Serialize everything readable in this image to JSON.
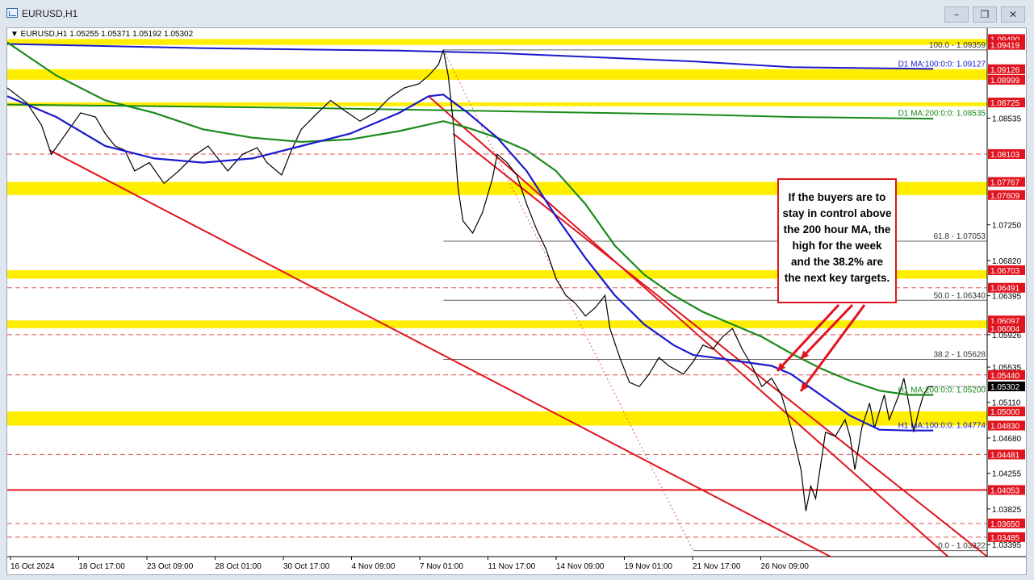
{
  "window": {
    "title": "EURUSD,H1",
    "buttons": [
      "–",
      "❐",
      "✕"
    ]
  },
  "chart_data": {
    "type": "line",
    "symbol_header": "▼ EURUSD,H1  1.05255 1.05371 1.05192 1.05302",
    "current_price": "1.05302",
    "ylim": [
      1.0325,
      1.0962
    ],
    "price_labels": [
      {
        "value": 1.0949,
        "text": "1.09490",
        "style": "box"
      },
      {
        "value": 1.09419,
        "text": "1.09419",
        "style": "box"
      },
      {
        "value": 1.09126,
        "text": "1.09126",
        "style": "box"
      },
      {
        "value": 1.08999,
        "text": "1.08999",
        "style": "box"
      },
      {
        "value": 1.08725,
        "text": "1.08725",
        "style": "box"
      },
      {
        "value": 1.08535,
        "text": "1.08535",
        "style": "plain"
      },
      {
        "value": 1.08103,
        "text": "1.08103",
        "style": "box"
      },
      {
        "value": 1.07767,
        "text": "1.07767",
        "style": "box"
      },
      {
        "value": 1.07609,
        "text": "1.07609",
        "style": "box"
      },
      {
        "value": 1.0725,
        "text": "1.07250",
        "style": "plain"
      },
      {
        "value": 1.0682,
        "text": "1.06820",
        "style": "plain"
      },
      {
        "value": 1.06703,
        "text": "1.06703",
        "style": "box"
      },
      {
        "value": 1.06491,
        "text": "1.06491",
        "style": "box"
      },
      {
        "value": 1.06395,
        "text": "1.06395",
        "style": "plain"
      },
      {
        "value": 1.06097,
        "text": "1.06097",
        "style": "box"
      },
      {
        "value": 1.06004,
        "text": "1.06004",
        "style": "box"
      },
      {
        "value": 1.05926,
        "text": "1.05926",
        "style": "plain"
      },
      {
        "value": 1.05535,
        "text": "1.05535",
        "style": "plain"
      },
      {
        "value": 1.0544,
        "text": "1.05440",
        "style": "box"
      },
      {
        "value": 1.05302,
        "text": "1.05302",
        "style": "current"
      },
      {
        "value": 1.0511,
        "text": "1.05110",
        "style": "plain"
      },
      {
        "value": 1.05,
        "text": "1.05000",
        "style": "box"
      },
      {
        "value": 1.0483,
        "text": "1.04830",
        "style": "box"
      },
      {
        "value": 1.0468,
        "text": "1.04680",
        "style": "plain"
      },
      {
        "value": 1.04481,
        "text": "1.04481",
        "style": "box"
      },
      {
        "value": 1.04255,
        "text": "1.04255",
        "style": "plain"
      },
      {
        "value": 1.04053,
        "text": "1.04053",
        "style": "box"
      },
      {
        "value": 1.03825,
        "text": "1.03825",
        "style": "plain"
      },
      {
        "value": 1.0365,
        "text": "1.03650",
        "style": "box"
      },
      {
        "value": 1.03485,
        "text": "1.03485",
        "style": "box"
      },
      {
        "value": 1.03395,
        "text": "1.03395",
        "style": "plain"
      }
    ],
    "yellow_zones": [
      [
        1.09419,
        1.0949
      ],
      [
        1.08999,
        1.09126
      ],
      [
        1.0868,
        1.08725
      ],
      [
        1.07609,
        1.07767
      ],
      [
        1.066,
        1.06703
      ],
      [
        1.06004,
        1.06097
      ],
      [
        1.0483,
        1.05
      ]
    ],
    "red_dashed_levels": [
      1.08103,
      1.06491,
      1.05926,
      1.0544,
      1.04481,
      1.0365,
      1.03485
    ],
    "support_level": 1.04053,
    "fib_levels": [
      {
        "value": 1.09359,
        "label": "100.0 - 1.09359",
        "x_start": 0.445
      },
      {
        "value": 1.07053,
        "label": "61.8 - 1.07053",
        "x_start": 0.445
      },
      {
        "value": 1.0634,
        "label": "50.0 - 1.06340",
        "x_start": 0.445
      },
      {
        "value": 1.05628,
        "label": "38.2 - 1.05628",
        "x_start": 0.445
      },
      {
        "value": 1.03322,
        "label": "0.0 - 1.03322",
        "x_start": 0.7
      }
    ],
    "ma_labels": [
      {
        "value": 1.09127,
        "label": "D1 MA:100:0:0: 1.09127",
        "color": "#1a1acc"
      },
      {
        "value": 1.08535,
        "label": "D1 MA:200:0:0: 1.08535",
        "color": "#1a8a1a"
      },
      {
        "value": 1.052,
        "label": "H1 MA:200:0:0: 1.05200",
        "color": "#1a8a1a"
      },
      {
        "value": 1.04774,
        "label": "H1 MA:100:0:0: 1.04774",
        "color": "#1a1acc"
      }
    ],
    "x_ticks": [
      "16 Oct 2024",
      "18 Oct 17:00",
      "23 Oct 09:00",
      "28 Oct 01:00",
      "30 Oct 17:00",
      "4 Nov 09:00",
      "7 Nov 01:00",
      "11 Nov 17:00",
      "14 Nov 09:00",
      "19 Nov 01:00",
      "21 Nov 17:00",
      "26 Nov 09:00"
    ],
    "price_path": [
      [
        0.0,
        1.089
      ],
      [
        0.02,
        1.0872
      ],
      [
        0.035,
        1.0845
      ],
      [
        0.045,
        1.081
      ],
      [
        0.06,
        1.0835
      ],
      [
        0.075,
        1.086
      ],
      [
        0.09,
        1.0855
      ],
      [
        0.1,
        1.0835
      ],
      [
        0.11,
        1.082
      ],
      [
        0.12,
        1.0815
      ],
      [
        0.13,
        1.079
      ],
      [
        0.145,
        1.08
      ],
      [
        0.16,
        1.0775
      ],
      [
        0.175,
        1.079
      ],
      [
        0.19,
        1.0808
      ],
      [
        0.205,
        1.082
      ],
      [
        0.215,
        1.0805
      ],
      [
        0.225,
        1.079
      ],
      [
        0.24,
        1.081
      ],
      [
        0.255,
        1.0818
      ],
      [
        0.265,
        1.08
      ],
      [
        0.28,
        1.0785
      ],
      [
        0.29,
        1.0815
      ],
      [
        0.3,
        1.084
      ],
      [
        0.315,
        1.0858
      ],
      [
        0.33,
        1.0875
      ],
      [
        0.345,
        1.0862
      ],
      [
        0.36,
        1.085
      ],
      [
        0.375,
        1.086
      ],
      [
        0.39,
        1.0878
      ],
      [
        0.405,
        1.089
      ],
      [
        0.42,
        1.0895
      ],
      [
        0.43,
        1.0905
      ],
      [
        0.44,
        1.0918
      ],
      [
        0.445,
        1.0936
      ],
      [
        0.45,
        1.0905
      ],
      [
        0.455,
        1.085
      ],
      [
        0.46,
        1.077
      ],
      [
        0.465,
        1.073
      ],
      [
        0.475,
        1.0715
      ],
      [
        0.485,
        1.074
      ],
      [
        0.495,
        1.078
      ],
      [
        0.5,
        1.081
      ],
      [
        0.51,
        1.08
      ],
      [
        0.52,
        1.0785
      ],
      [
        0.53,
        1.075
      ],
      [
        0.54,
        1.072
      ],
      [
        0.55,
        1.0695
      ],
      [
        0.56,
        1.066
      ],
      [
        0.57,
        1.064
      ],
      [
        0.58,
        1.063
      ],
      [
        0.59,
        1.0615
      ],
      [
        0.6,
        1.0625
      ],
      [
        0.61,
        1.064
      ],
      [
        0.615,
        1.06
      ],
      [
        0.625,
        1.0565
      ],
      [
        0.635,
        1.0535
      ],
      [
        0.645,
        1.053
      ],
      [
        0.655,
        1.0545
      ],
      [
        0.665,
        1.0565
      ],
      [
        0.675,
        1.0555
      ],
      [
        0.69,
        1.0545
      ],
      [
        0.7,
        1.056
      ],
      [
        0.71,
        1.058
      ],
      [
        0.72,
        1.0575
      ],
      [
        0.73,
        1.059
      ],
      [
        0.74,
        1.06
      ],
      [
        0.75,
        1.0575
      ],
      [
        0.76,
        1.0555
      ],
      [
        0.77,
        1.053
      ],
      [
        0.78,
        1.054
      ],
      [
        0.79,
        1.052
      ],
      [
        0.8,
        1.048
      ],
      [
        0.81,
        1.043
      ],
      [
        0.815,
        1.038
      ],
      [
        0.82,
        1.041
      ],
      [
        0.825,
        1.0395
      ],
      [
        0.835,
        1.0475
      ],
      [
        0.845,
        1.047
      ],
      [
        0.855,
        1.049
      ],
      [
        0.86,
        1.047
      ],
      [
        0.865,
        1.043
      ],
      [
        0.872,
        1.048
      ],
      [
        0.88,
        1.051
      ],
      [
        0.885,
        1.048
      ],
      [
        0.89,
        1.05
      ],
      [
        0.895,
        1.052
      ],
      [
        0.9,
        1.049
      ],
      [
        0.91,
        1.052
      ],
      [
        0.915,
        1.054
      ],
      [
        0.92,
        1.051
      ],
      [
        0.925,
        1.0475
      ],
      [
        0.93,
        1.05
      ],
      [
        0.935,
        1.052
      ],
      [
        0.94,
        1.053
      ],
      [
        0.945,
        1.053
      ]
    ],
    "ma_h1_100": [
      [
        0.0,
        1.088
      ],
      [
        0.05,
        1.0855
      ],
      [
        0.1,
        1.082
      ],
      [
        0.15,
        1.0805
      ],
      [
        0.2,
        1.08
      ],
      [
        0.25,
        1.0805
      ],
      [
        0.3,
        1.082
      ],
      [
        0.35,
        1.0835
      ],
      [
        0.4,
        1.086
      ],
      [
        0.43,
        1.088
      ],
      [
        0.445,
        1.0882
      ],
      [
        0.47,
        1.086
      ],
      [
        0.5,
        1.083
      ],
      [
        0.53,
        1.079
      ],
      [
        0.56,
        1.0735
      ],
      [
        0.59,
        1.0685
      ],
      [
        0.62,
        1.064
      ],
      [
        0.65,
        1.0605
      ],
      [
        0.68,
        1.058
      ],
      [
        0.7,
        1.0568
      ],
      [
        0.72,
        1.0565
      ],
      [
        0.75,
        1.056
      ],
      [
        0.78,
        1.0555
      ],
      [
        0.8,
        1.0545
      ],
      [
        0.83,
        1.052
      ],
      [
        0.86,
        1.0495
      ],
      [
        0.89,
        1.0478
      ],
      [
        0.92,
        1.0477
      ],
      [
        0.945,
        1.0477
      ]
    ],
    "ma_h1_200": [
      [
        0.0,
        1.0945
      ],
      [
        0.05,
        1.0905
      ],
      [
        0.1,
        1.0875
      ],
      [
        0.15,
        1.086
      ],
      [
        0.2,
        1.084
      ],
      [
        0.25,
        1.083
      ],
      [
        0.3,
        1.0825
      ],
      [
        0.35,
        1.0828
      ],
      [
        0.4,
        1.0838
      ],
      [
        0.445,
        1.085
      ],
      [
        0.47,
        1.0842
      ],
      [
        0.5,
        1.083
      ],
      [
        0.53,
        1.0815
      ],
      [
        0.56,
        1.079
      ],
      [
        0.59,
        1.075
      ],
      [
        0.62,
        1.07
      ],
      [
        0.65,
        1.0665
      ],
      [
        0.68,
        1.064
      ],
      [
        0.71,
        1.062
      ],
      [
        0.74,
        1.0605
      ],
      [
        0.77,
        1.059
      ],
      [
        0.8,
        1.057
      ],
      [
        0.83,
        1.0552
      ],
      [
        0.86,
        1.0537
      ],
      [
        0.89,
        1.0525
      ],
      [
        0.92,
        1.052
      ],
      [
        0.945,
        1.052
      ]
    ],
    "ma_d1_100": [
      [
        0.0,
        1.0943
      ],
      [
        0.2,
        1.0938
      ],
      [
        0.4,
        1.0935
      ],
      [
        0.5,
        1.0932
      ],
      [
        0.7,
        1.0922
      ],
      [
        0.8,
        1.0915
      ],
      [
        0.945,
        1.0913
      ]
    ],
    "ma_d1_200": [
      [
        0.0,
        1.087
      ],
      [
        0.3,
        1.0866
      ],
      [
        0.5,
        1.0862
      ],
      [
        0.7,
        1.0858
      ],
      [
        0.8,
        1.0855
      ],
      [
        0.945,
        1.0853
      ]
    ],
    "channel_lines": [
      {
        "from": [
          0.043,
          1.0815
        ],
        "to": [
          0.84,
          1.0325
        ]
      },
      {
        "from": [
          0.43,
          1.088
        ],
        "to": [
          0.96,
          1.0325
        ]
      },
      {
        "from": [
          0.455,
          1.0835
        ],
        "to": [
          1.0,
          1.0325
        ]
      }
    ],
    "fib_dotted_line": {
      "from": [
        0.445,
        1.0936
      ],
      "to": [
        0.7,
        1.0332
      ]
    },
    "annotation_text": "If the buyers are to stay in control above the 200 hour MA, the high for the week and the 38.2% are the next key targets."
  }
}
